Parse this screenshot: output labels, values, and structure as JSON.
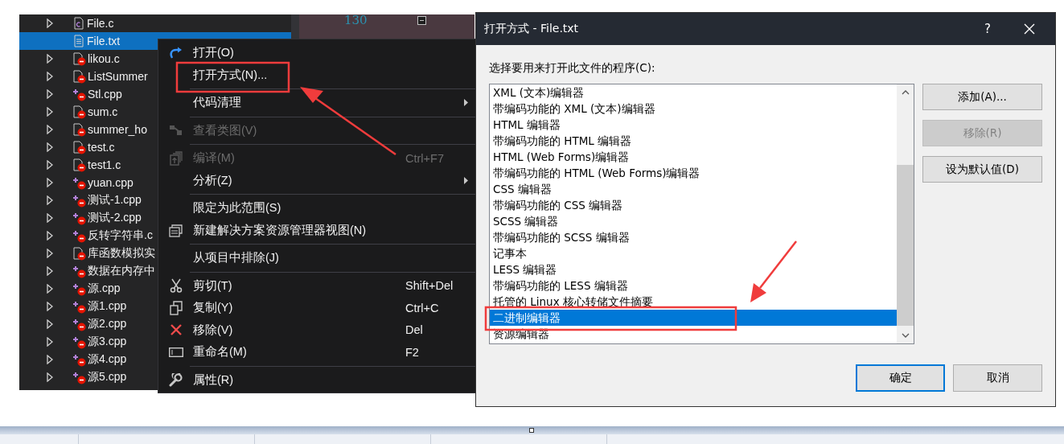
{
  "solution_explorer": {
    "items": [
      {
        "label": "File.c",
        "kind": "c",
        "expandable": true,
        "selected": false
      },
      {
        "label": "File.txt",
        "kind": "text",
        "expandable": false,
        "selected": true
      },
      {
        "label": "likou.c",
        "kind": "source",
        "expandable": true,
        "selected": false
      },
      {
        "label": "ListSummer",
        "kind": "source",
        "expandable": true,
        "selected": false
      },
      {
        "label": "Stl.cpp",
        "kind": "cpp",
        "expandable": true,
        "selected": false
      },
      {
        "label": "sum.c",
        "kind": "source",
        "expandable": true,
        "selected": false
      },
      {
        "label": "summer_ho",
        "kind": "source",
        "expandable": true,
        "selected": false
      },
      {
        "label": "test.c",
        "kind": "source",
        "expandable": true,
        "selected": false
      },
      {
        "label": "test1.c",
        "kind": "source",
        "expandable": true,
        "selected": false
      },
      {
        "label": "yuan.cpp",
        "kind": "cpp",
        "expandable": true,
        "selected": false
      },
      {
        "label": "测试-1.cpp",
        "kind": "cpp",
        "expandable": true,
        "selected": false
      },
      {
        "label": "测试-2.cpp",
        "kind": "cpp",
        "expandable": true,
        "selected": false
      },
      {
        "label": "反转字符串.c",
        "kind": "cpp",
        "expandable": true,
        "selected": false
      },
      {
        "label": "库函数模拟实",
        "kind": "source",
        "expandable": true,
        "selected": false
      },
      {
        "label": "数据在内存中",
        "kind": "cpp",
        "expandable": true,
        "selected": false
      },
      {
        "label": "源.cpp",
        "kind": "cpp",
        "expandable": true,
        "selected": false
      },
      {
        "label": "源1.cpp",
        "kind": "cpp",
        "expandable": true,
        "selected": false
      },
      {
        "label": "源2.cpp",
        "kind": "cpp",
        "expandable": true,
        "selected": false
      },
      {
        "label": "源3.cpp",
        "kind": "cpp",
        "expandable": true,
        "selected": false
      },
      {
        "label": "源4.cpp",
        "kind": "cpp",
        "expandable": true,
        "selected": false
      },
      {
        "label": "源5.cpp",
        "kind": "cpp",
        "expandable": true,
        "selected": false
      }
    ]
  },
  "editor": {
    "line_number": "130"
  },
  "context_menu": {
    "items": [
      {
        "kind": "item",
        "label": "打开(O)",
        "disabled": false,
        "submenu": false
      },
      {
        "kind": "item",
        "label": "打开方式(N)...",
        "disabled": false,
        "submenu": false
      },
      {
        "kind": "separator"
      },
      {
        "kind": "item",
        "label": "代码清理",
        "disabled": false,
        "submenu": true
      },
      {
        "kind": "separator"
      },
      {
        "kind": "item",
        "label": "查看类图(V)",
        "disabled": true,
        "submenu": false
      },
      {
        "kind": "separator"
      },
      {
        "kind": "item",
        "label": "编译(M)",
        "shortcut": "Ctrl+F7",
        "disabled": true,
        "submenu": false
      },
      {
        "kind": "item",
        "label": "分析(Z)",
        "disabled": false,
        "submenu": true
      },
      {
        "kind": "separator"
      },
      {
        "kind": "item",
        "label": "限定为此范围(S)",
        "disabled": false,
        "submenu": false
      },
      {
        "kind": "item",
        "label": "新建解决方案资源管理器视图(N)",
        "disabled": false,
        "submenu": false
      },
      {
        "kind": "separator"
      },
      {
        "kind": "item",
        "label": "从项目中排除(J)",
        "disabled": false,
        "submenu": false
      },
      {
        "kind": "separator"
      },
      {
        "kind": "item",
        "label": "剪切(T)",
        "shortcut": "Shift+Del",
        "disabled": false,
        "submenu": false
      },
      {
        "kind": "item",
        "label": "复制(Y)",
        "shortcut": "Ctrl+C",
        "disabled": false,
        "submenu": false
      },
      {
        "kind": "item",
        "label": "移除(V)",
        "shortcut": "Del",
        "disabled": false,
        "submenu": false
      },
      {
        "kind": "item",
        "label": "重命名(M)",
        "shortcut": "F2",
        "disabled": false,
        "submenu": false
      },
      {
        "kind": "separator"
      },
      {
        "kind": "item",
        "label": "属性(R)",
        "disabled": false,
        "submenu": false
      }
    ]
  },
  "dialog": {
    "title": "打开方式 - File.txt",
    "help": "?",
    "prompt": "选择要用来打开此文件的程序(C):",
    "programs": [
      {
        "label": "XML (文本)编辑器",
        "selected": false
      },
      {
        "label": "带编码功能的 XML (文本)编辑器",
        "selected": false
      },
      {
        "label": "HTML 编辑器",
        "selected": false
      },
      {
        "label": "带编码功能的 HTML 编辑器",
        "selected": false
      },
      {
        "label": "HTML (Web Forms)编辑器",
        "selected": false
      },
      {
        "label": "带编码功能的 HTML (Web Forms)编辑器",
        "selected": false
      },
      {
        "label": "CSS 编辑器",
        "selected": false
      },
      {
        "label": "带编码功能的 CSS 编辑器",
        "selected": false
      },
      {
        "label": "SCSS 编辑器",
        "selected": false
      },
      {
        "label": "带编码功能的 SCSS 编辑器",
        "selected": false
      },
      {
        "label": "记事本",
        "selected": false
      },
      {
        "label": "LESS 编辑器",
        "selected": false
      },
      {
        "label": "带编码功能的 LESS 编辑器",
        "selected": false
      },
      {
        "label": "托管的 Linux 核心转储文件摘要",
        "selected": false
      },
      {
        "label": "二进制编辑器",
        "selected": true
      },
      {
        "label": "资源编辑器",
        "selected": false
      }
    ],
    "side_buttons": [
      {
        "label": "添加(A)...",
        "disabled": false
      },
      {
        "label": "移除(R)",
        "disabled": true
      },
      {
        "label": "设为默认值(D)",
        "disabled": false
      }
    ],
    "footer_buttons": [
      {
        "label": "确定",
        "default": true
      },
      {
        "label": "取消",
        "default": false
      }
    ]
  }
}
